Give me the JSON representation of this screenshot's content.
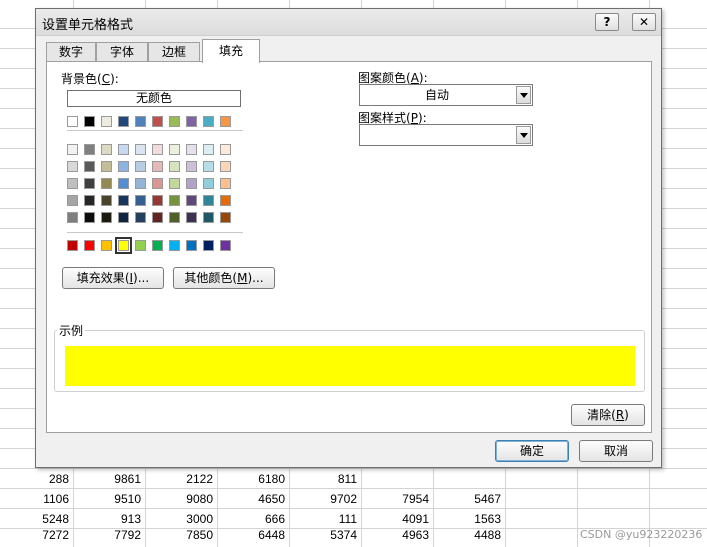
{
  "sheet": {
    "rows": [
      [
        "288",
        "9861",
        "2122",
        "6180",
        "811",
        "",
        ""
      ],
      [
        "1106",
        "9510",
        "9080",
        "4650",
        "9702",
        "7954",
        "5467"
      ],
      [
        "5248",
        "913",
        "3000",
        "666",
        "111",
        "4091",
        "1563"
      ],
      [
        "7272",
        "7792",
        "7850",
        "6448",
        "5374",
        "4963",
        "4488"
      ]
    ]
  },
  "dialog": {
    "title": "设置单元格格式",
    "help_label": "?",
    "close_label": "✕",
    "tabs": [
      {
        "label": "数字"
      },
      {
        "label": "字体"
      },
      {
        "label": "边框"
      },
      {
        "label": "填充"
      }
    ],
    "fill": {
      "bg_color_label": "背景色",
      "bg_color_key": "C",
      "no_color_label": "无颜色",
      "theme_row": [
        "#ffffff",
        "#000000",
        "#eeece1",
        "#1f497d",
        "#4f81bd",
        "#c0504d",
        "#9bbb59",
        "#8064a2",
        "#4bacc6",
        "#f79646"
      ],
      "shade_rows": [
        [
          "#f2f2f2",
          "#7f7f7f",
          "#ddd9c3",
          "#c6d9f0",
          "#dbe5f1",
          "#f2dcdb",
          "#ebf1dd",
          "#e5e0ec",
          "#dbeef3",
          "#fdeada"
        ],
        [
          "#d8d8d8",
          "#595959",
          "#c4bd97",
          "#8db3e2",
          "#b8cce4",
          "#e5b9b7",
          "#d7e3bc",
          "#ccc1d9",
          "#b7dde8",
          "#fbd5b5"
        ],
        [
          "#bfbfbf",
          "#3f3f3f",
          "#938953",
          "#548dd4",
          "#95b3d7",
          "#d99694",
          "#c3d69b",
          "#b2a2c7",
          "#92cddc",
          "#fac08f"
        ],
        [
          "#a5a5a5",
          "#262626",
          "#494429",
          "#17365d",
          "#366092",
          "#953734",
          "#76923c",
          "#5f497a",
          "#31859b",
          "#e36c09"
        ],
        [
          "#7f7f7f",
          "#0c0c0c",
          "#1d1b10",
          "#0f243e",
          "#244061",
          "#632423",
          "#4f6128",
          "#3f3151",
          "#205867",
          "#974806"
        ]
      ],
      "standard_row": [
        "#c00000",
        "#ff0000",
        "#ffc000",
        "#ffff00",
        "#92d050",
        "#00b050",
        "#00b0f0",
        "#0070c0",
        "#002060",
        "#7030a0"
      ],
      "selected_color": "#ffff00",
      "fill_effects_label": "填充效果",
      "fill_effects_key": "I",
      "more_colors_label": "其他颜色",
      "more_colors_key": "M",
      "ellipsis": "...",
      "pattern_color_label": "图案颜色",
      "pattern_color_key": "A",
      "pattern_color_value": "自动",
      "pattern_style_label": "图案样式",
      "pattern_style_key": "P",
      "pattern_style_value": "",
      "sample_label": "示例",
      "sample_color": "#ffff00",
      "clear_label": "清除",
      "clear_key": "R"
    },
    "ok_label": "确定",
    "cancel_label": "取消"
  },
  "watermark": "CSDN @yu923220236"
}
